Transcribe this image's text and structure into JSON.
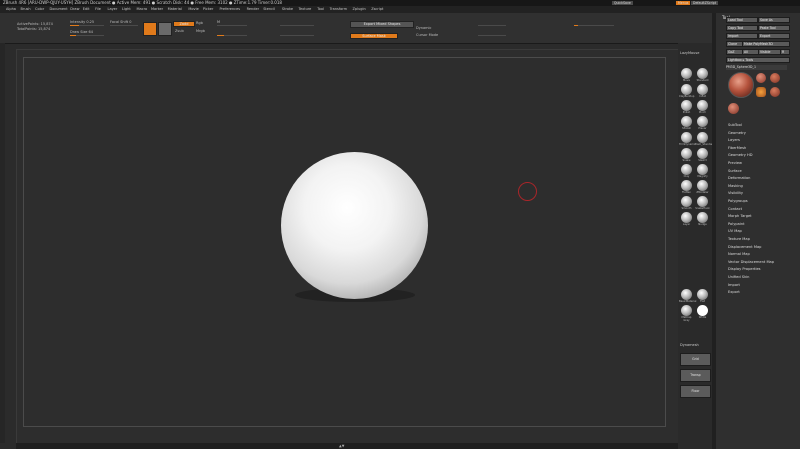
{
  "titlebar": {
    "title": "ZBrush 4R6 [ARU-DWP-QJUY-USYH]    ZBrush Document    ● Active Mem: 491 ● Scratch Disk: 44 ● Free Mem: 3102 ● ZTime:1.79 Timer:0.018",
    "quicksave": "QuickSave",
    "menus_btn": "Menus",
    "script_btn": "DefaultZScript"
  },
  "menubar": [
    "Alpha",
    "Brush",
    "Color",
    "Document",
    "Draw",
    "Edit",
    "File",
    "Layer",
    "Light",
    "Macro",
    "Marker",
    "Material",
    "Movie",
    "Picker",
    "Preferences",
    "Render",
    "Stencil",
    "Stroke",
    "Texture",
    "Tool",
    "Transform",
    "Zplugin",
    "Zscript"
  ],
  "shelf": {
    "active_points": "ActivePoints: 15,874",
    "total_points": "TotalPoints: 15,874",
    "intensity": "Intensity 0.25",
    "focal_shift": "Focal Shift 0",
    "draw_size": "Draw Size 64",
    "zadd": "Zadd",
    "zsub": "Zsub",
    "rgb": "Rgb",
    "mrgb": "Mrgb",
    "m": "M",
    "export_btn": "Export Mixed Shapes",
    "surface_btn": "Surface Mask",
    "perspective": "Persp",
    "floor": "Floor",
    "transp": "Transp",
    "dynamic": "Dynamic",
    "cursor_mode": "Cursor Mode"
  },
  "canvas": {
    "bottom_label": "▲▼"
  },
  "brushshelf": {
    "title": "LazyMouse",
    "brushes": [
      {
        "row": 0,
        "a": "Move",
        "b": "Standard"
      },
      {
        "row": 1,
        "a": "ClayBuildup",
        "b": "Inflat"
      },
      {
        "row": 2,
        "a": "Polish",
        "b": "Pinch"
      },
      {
        "row": 3,
        "a": "hPolish",
        "b": "Planar"
      },
      {
        "row": 4,
        "a": "TrimDynamic",
        "b": "Dam_Standard"
      },
      {
        "row": 5,
        "a": "Snake",
        "b": "Slash3"
      },
      {
        "row": 6,
        "a": "Clay",
        "b": "Magnify"
      },
      {
        "row": 7,
        "a": "Flatten",
        "b": "ZModeler"
      },
      {
        "row": 8,
        "a": "Smooth",
        "b": "SnakeHook"
      },
      {
        "row": 9,
        "a": "Layer",
        "b": "Nudge"
      }
    ],
    "materials": [
      {
        "a": "BasicMaterial",
        "b": "Flat"
      },
      {
        "a": "MatCap Gray",
        "b": "White"
      }
    ],
    "dynamesh": "Dynamesh",
    "buttons": [
      "Grid",
      "Transp",
      "Floor"
    ]
  },
  "tool": {
    "title": "Tool",
    "buttons": [
      [
        "Load Tool",
        "Save As"
      ],
      [
        "Copy Tool",
        "Paste Tool"
      ],
      [
        "Import",
        "Export"
      ],
      [
        "Clone",
        "Make PolyMesh3D"
      ],
      [
        "GoZ",
        "All",
        "Visible",
        "R"
      ]
    ],
    "lightbox": "Lightbox ▸ Tools",
    "value": "PM3D_Sphere3D_1",
    "sections": [
      "SubTool",
      "Geometry",
      "Layers",
      "FiberMesh",
      "Geometry HD",
      "Preview",
      "Surface",
      "Deformation",
      "Masking",
      "Visibility",
      "Polygroups",
      "Contact",
      "Morph Target",
      "Polypaint",
      "UV Map",
      "Texture Map",
      "Displacement Map",
      "Normal Map",
      "Vector Displacement Map",
      "Display Properties",
      "Unified Skin",
      "Import",
      "Export"
    ]
  },
  "colors": {
    "accent": "#e07a1b",
    "brush_cursor": "#a8262a",
    "canvas": "#2d2d2d"
  }
}
